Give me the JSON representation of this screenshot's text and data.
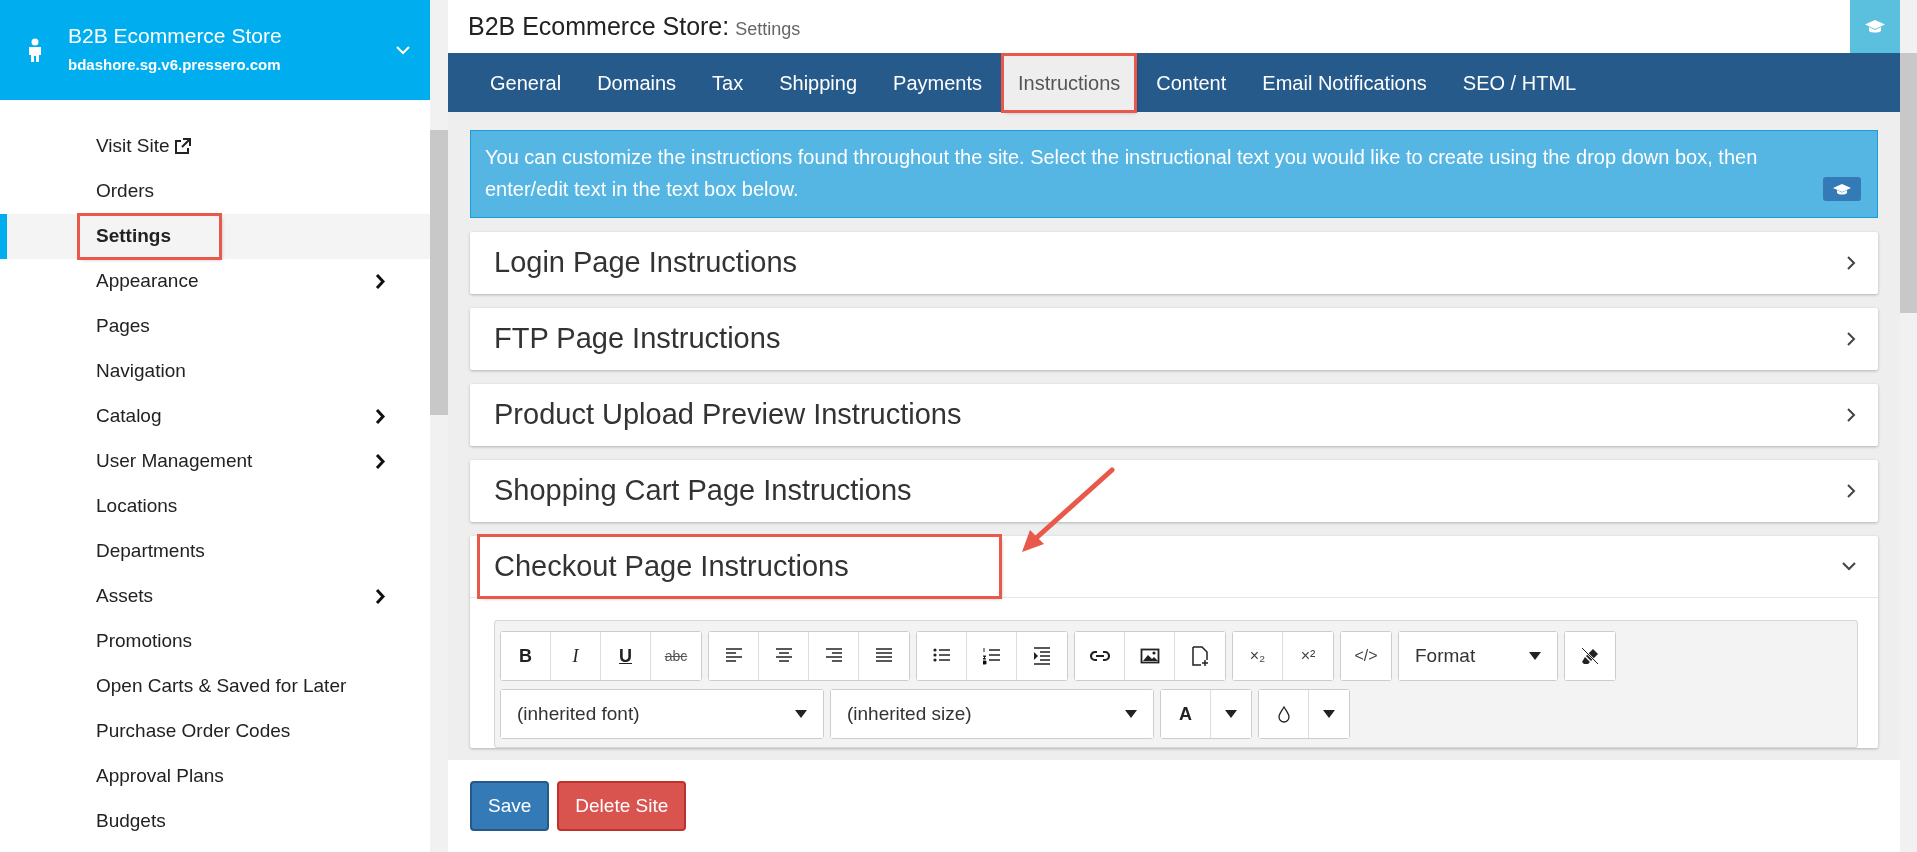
{
  "sidebar": {
    "store_name": "B2B Ecommerce Store",
    "domain": "bdashore.sg.v6.pressero.com",
    "items": [
      {
        "label": "Visit Site",
        "external": true,
        "has_submenu": false,
        "selected": false,
        "highlighted": false
      },
      {
        "label": "Orders",
        "external": false,
        "has_submenu": false,
        "selected": false,
        "highlighted": false
      },
      {
        "label": "Settings",
        "external": false,
        "has_submenu": false,
        "selected": true,
        "highlighted": true
      },
      {
        "label": "Appearance",
        "external": false,
        "has_submenu": true,
        "selected": false,
        "highlighted": false
      },
      {
        "label": "Pages",
        "external": false,
        "has_submenu": false,
        "selected": false,
        "highlighted": false
      },
      {
        "label": "Navigation",
        "external": false,
        "has_submenu": false,
        "selected": false,
        "highlighted": false
      },
      {
        "label": "Catalog",
        "external": false,
        "has_submenu": true,
        "selected": false,
        "highlighted": false
      },
      {
        "label": "User Management",
        "external": false,
        "has_submenu": true,
        "selected": false,
        "highlighted": false
      },
      {
        "label": "Locations",
        "external": false,
        "has_submenu": false,
        "selected": false,
        "highlighted": false
      },
      {
        "label": "Departments",
        "external": false,
        "has_submenu": false,
        "selected": false,
        "highlighted": false
      },
      {
        "label": "Assets",
        "external": false,
        "has_submenu": true,
        "selected": false,
        "highlighted": false
      },
      {
        "label": "Promotions",
        "external": false,
        "has_submenu": false,
        "selected": false,
        "highlighted": false
      },
      {
        "label": "Open Carts & Saved for Later",
        "external": false,
        "has_submenu": false,
        "selected": false,
        "highlighted": false
      },
      {
        "label": "Purchase Order Codes",
        "external": false,
        "has_submenu": false,
        "selected": false,
        "highlighted": false
      },
      {
        "label": "Approval Plans",
        "external": false,
        "has_submenu": false,
        "selected": false,
        "highlighted": false
      },
      {
        "label": "Budgets",
        "external": false,
        "has_submenu": false,
        "selected": false,
        "highlighted": false
      }
    ]
  },
  "header": {
    "title": "B2B Ecommerce Store:",
    "subtitle": "Settings"
  },
  "tabs": [
    {
      "label": "General",
      "selected": false,
      "highlighted": false
    },
    {
      "label": "Domains",
      "selected": false,
      "highlighted": false
    },
    {
      "label": "Tax",
      "selected": false,
      "highlighted": false
    },
    {
      "label": "Shipping",
      "selected": false,
      "highlighted": false
    },
    {
      "label": "Payments",
      "selected": false,
      "highlighted": false
    },
    {
      "label": "Instructions",
      "selected": true,
      "highlighted": true
    },
    {
      "label": "Content",
      "selected": false,
      "highlighted": false
    },
    {
      "label": "Email Notifications",
      "selected": false,
      "highlighted": false
    },
    {
      "label": "SEO / HTML",
      "selected": false,
      "highlighted": false
    }
  ],
  "info": "You can customize the instructions found throughout the site. Select the instructional text you would like to create using the drop down box, then enter/edit text in the text box below.",
  "sections": [
    {
      "title": "Login Page Instructions",
      "expanded": false,
      "highlighted": false
    },
    {
      "title": "FTP Page Instructions",
      "expanded": false,
      "highlighted": false
    },
    {
      "title": "Product Upload Preview Instructions",
      "expanded": false,
      "highlighted": false
    },
    {
      "title": "Shopping Cart Page Instructions",
      "expanded": false,
      "highlighted": false
    },
    {
      "title": "Checkout Page Instructions",
      "expanded": true,
      "highlighted": true
    }
  ],
  "editor": {
    "rows": [
      [
        [
          {
            "kind": "bold",
            "label": "B"
          },
          {
            "kind": "italic",
            "label": "I"
          },
          {
            "kind": "underline",
            "label": "U"
          },
          {
            "kind": "strike",
            "label": "abc"
          }
        ],
        [
          {
            "kind": "icon"
          },
          {
            "kind": "icon"
          },
          {
            "kind": "icon"
          },
          {
            "kind": "icon"
          }
        ],
        [
          {
            "kind": "icon"
          },
          {
            "kind": "icon"
          },
          {
            "kind": "icon"
          }
        ],
        [
          {
            "kind": "icon"
          },
          {
            "kind": "icon"
          },
          {
            "kind": "icon"
          }
        ],
        [
          {
            "kind": "text",
            "label": "×₂"
          },
          {
            "kind": "text",
            "label": "×²"
          }
        ],
        [
          {
            "kind": "text",
            "label": "</>"
          }
        ],
        [
          {
            "kind": "dropdown",
            "value": "Format"
          }
        ],
        [
          {
            "kind": "icon"
          }
        ]
      ],
      [
        [
          {
            "kind": "dropdown",
            "value": "(inherited font)",
            "wide": true
          }
        ],
        [
          {
            "kind": "dropdown",
            "value": "(inherited size)",
            "wide": true
          }
        ],
        [
          {
            "kind": "bold",
            "label": "A"
          },
          {
            "kind": "caret"
          }
        ],
        [
          {
            "kind": "icon"
          },
          {
            "kind": "caret"
          }
        ]
      ]
    ]
  },
  "buttons": [
    {
      "label": "Save",
      "kind": "primary"
    },
    {
      "label": "Delete Site",
      "kind": "danger"
    }
  ]
}
